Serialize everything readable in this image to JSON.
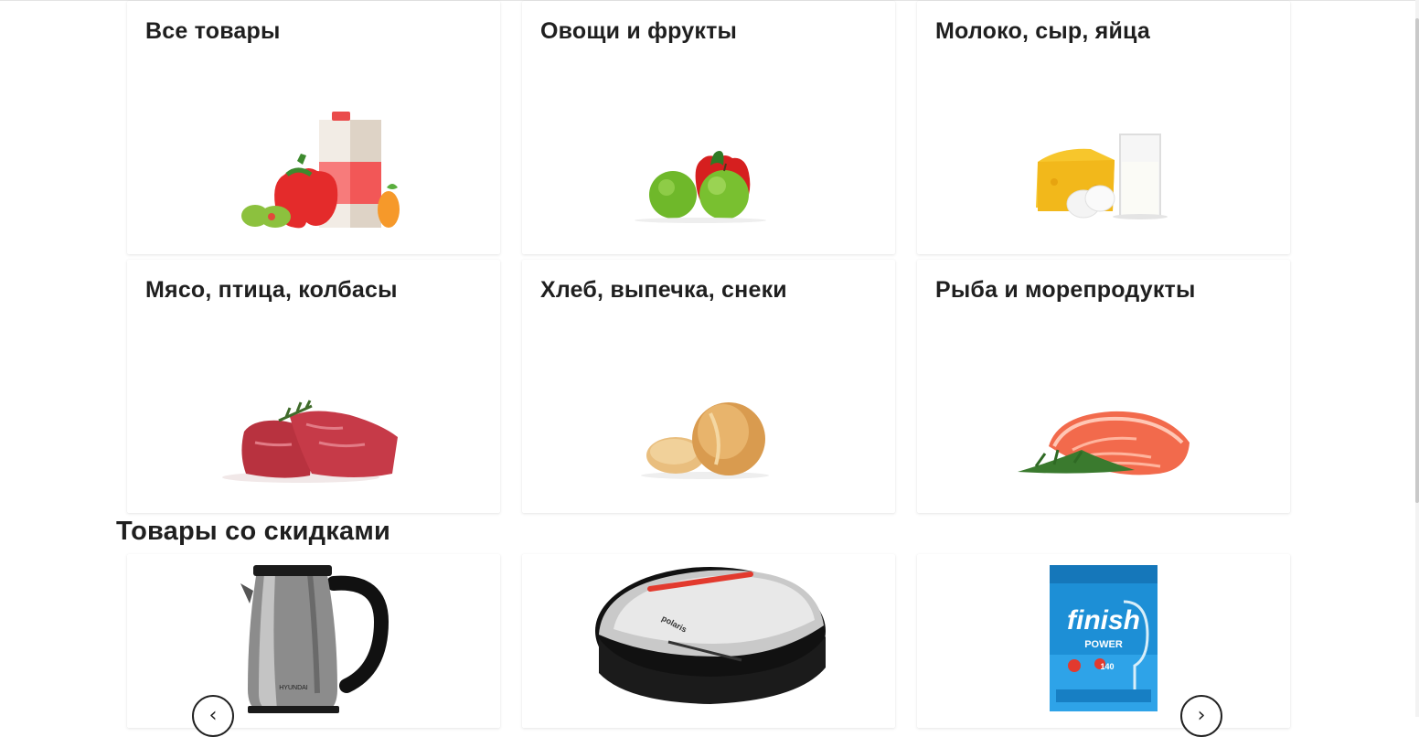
{
  "categories": [
    {
      "title": "Все товары",
      "icon": "grocery-bag-icon"
    },
    {
      "title": "Овощи и фрукты",
      "icon": "apples-pepper-icon"
    },
    {
      "title": "Молоко, сыр, яйца",
      "icon": "cheese-milk-eggs-icon"
    },
    {
      "title": "Мясо, птица, колбасы",
      "icon": "meat-icon"
    },
    {
      "title": "Хлеб, выпечка, снеки",
      "icon": "bread-icon"
    },
    {
      "title": "Рыба и морепродукты",
      "icon": "salmon-icon"
    }
  ],
  "discounts": {
    "title": "Товары со скидками",
    "products": [
      {
        "image": "electric-kettle-image",
        "brand": "HYUNDAI"
      },
      {
        "image": "sandwich-maker-image",
        "brand": "polaris"
      },
      {
        "image": "dishwasher-tablets-image",
        "brand": "finish",
        "line": "POWER",
        "count": "140"
      }
    ],
    "prev_arrow": "‹",
    "next_arrow": "›"
  },
  "colors": {
    "accent_red": "#e23a2e",
    "finish_blue": "#1d8fd6",
    "text": "#1f1f1f"
  }
}
